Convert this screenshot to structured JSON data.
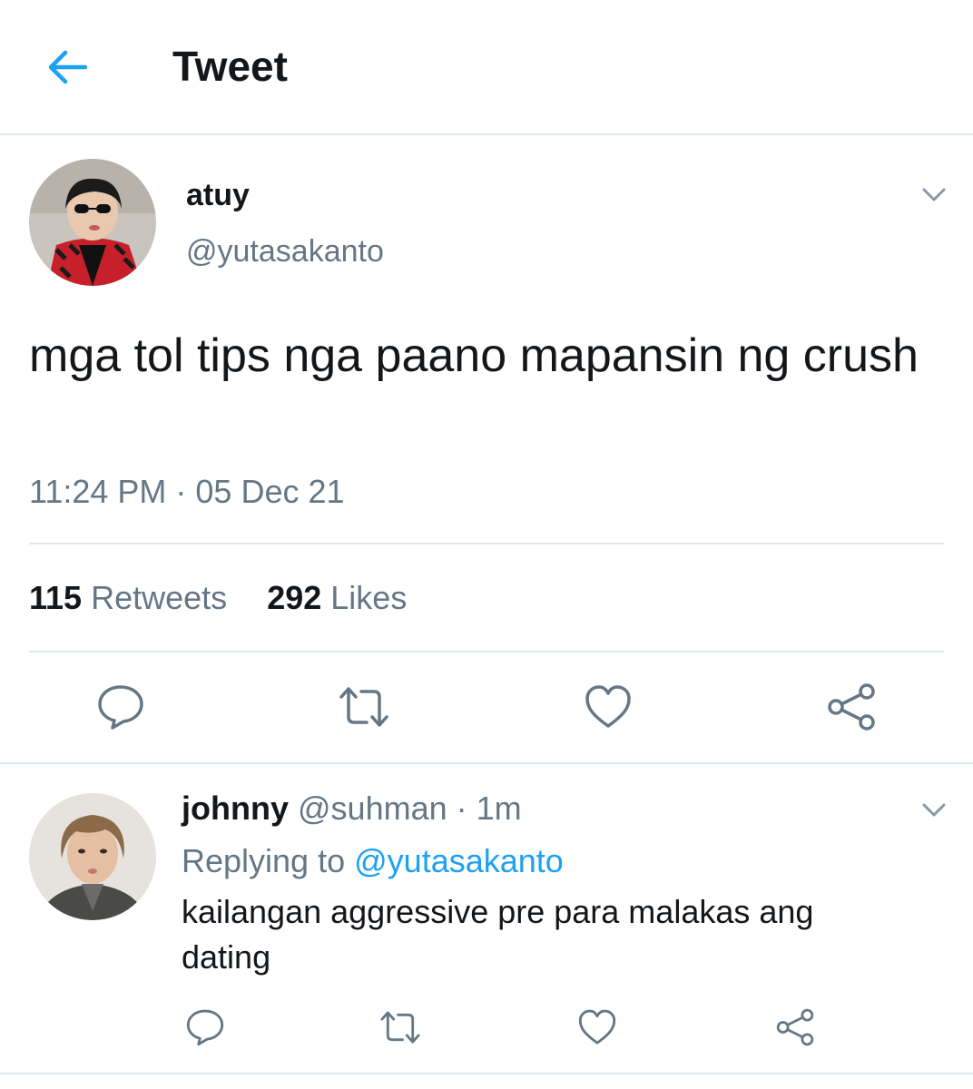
{
  "header": {
    "title": "Tweet",
    "back_icon": "arrow-left-icon"
  },
  "tweet": {
    "display_name": "atuy",
    "handle": "@yutasakanto",
    "text": "mga tol tips nga paano mapansin ng crush",
    "timestamp": "11:24 PM · 05 Dec 21",
    "stats": {
      "retweets_count": "115",
      "retweets_label": "Retweets",
      "likes_count": "292",
      "likes_label": "Likes"
    },
    "actions": [
      "reply-icon",
      "retweet-icon",
      "like-icon",
      "share-icon"
    ]
  },
  "reply": {
    "display_name": "johnny",
    "handle": "@suhman",
    "time": "· 1m",
    "replying_label": "Replying to",
    "replying_handle": "@yutasakanto",
    "text": "kailangan aggressive pre para malakas ang dating"
  },
  "colors": {
    "accent": "#1da1f2",
    "secondary_text": "#657786",
    "primary_text": "#14171a",
    "divider": "#e1e8ed"
  }
}
